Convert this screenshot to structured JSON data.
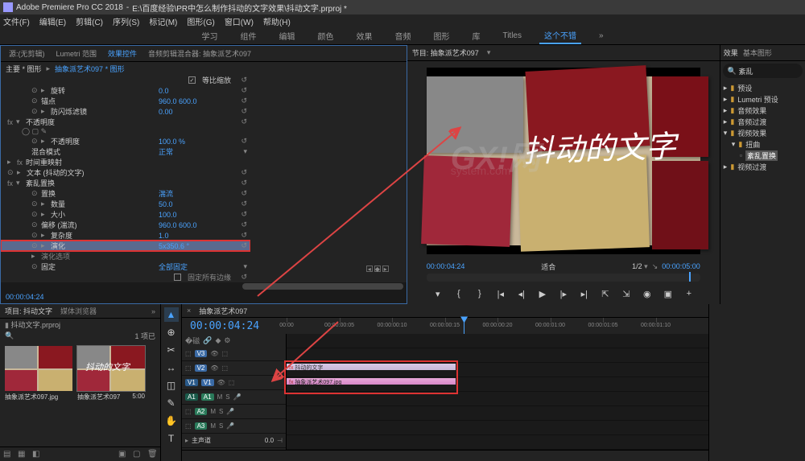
{
  "title_bar": {
    "app": "Adobe Premiere Pro CC 2018",
    "path": "E:\\百度经验\\PR中怎么制作抖动的文字效果\\抖动文字.prproj *"
  },
  "menu": [
    "文件(F)",
    "编辑(E)",
    "剪辑(C)",
    "序列(S)",
    "标记(M)",
    "图形(G)",
    "窗口(W)",
    "帮助(H)"
  ],
  "workspaces": {
    "items": [
      "学习",
      "组件",
      "编辑",
      "颜色",
      "效果",
      "音频",
      "图形",
      "库",
      "Titles"
    ],
    "active": "这个不错",
    "more": "»"
  },
  "effect_controls": {
    "tabs": [
      "源:(无剪辑)",
      "Lumetri 范围",
      "效果控件",
      "音频剪辑混合器: 抽象派艺术097"
    ],
    "active_tab": "效果控件",
    "master_label": "主要 * 图形",
    "clip_link": "抽象派艺术097 * 图形",
    "check_label": "等比缩放",
    "rows": [
      {
        "type": "prop",
        "indent": 2,
        "name": "旋转",
        "val": "0.0"
      },
      {
        "type": "prop",
        "indent": 2,
        "name": "锚点",
        "val": "960.0   600.0"
      },
      {
        "type": "prop",
        "indent": 2,
        "name": "防闪烁滤镜",
        "val": "0.00"
      },
      {
        "type": "fx",
        "indent": 0,
        "name": "不透明度"
      },
      {
        "type": "mask",
        "indent": 1,
        "name": "◯ ▢ ✎"
      },
      {
        "type": "prop",
        "indent": 2,
        "name": "不透明度",
        "val": "100.0 %"
      },
      {
        "type": "prop",
        "indent": 2,
        "name": "混合模式",
        "val": "正常"
      },
      {
        "type": "fx",
        "indent": 0,
        "name": "时间重映射"
      },
      {
        "type": "fx",
        "indent": 0,
        "name": "文本 (抖动的文字)"
      },
      {
        "type": "fx",
        "indent": 0,
        "name": "紊乱置换"
      },
      {
        "type": "prop",
        "indent": 2,
        "name": "置换",
        "val": "湍流"
      },
      {
        "type": "prop",
        "indent": 2,
        "name": "数量",
        "val": "50.0"
      },
      {
        "type": "prop",
        "indent": 2,
        "name": "大小",
        "val": "100.0"
      },
      {
        "type": "prop",
        "indent": 2,
        "name": "偏移 (湍流)",
        "val": "960.0   600.0"
      },
      {
        "type": "prop",
        "indent": 2,
        "name": "复杂度",
        "val": "1.0"
      },
      {
        "type": "prop",
        "indent": 2,
        "name": "演化",
        "val": "5x350.6 °",
        "hl": true
      },
      {
        "type": "prop",
        "indent": 2,
        "name": "演化选项",
        "val": ""
      },
      {
        "type": "prop",
        "indent": 2,
        "name": "固定",
        "val": "全部固定"
      }
    ],
    "pin_check": "固定所有边缘",
    "timecode": "00:00:04:24"
  },
  "program": {
    "title": "节目: 抽象派艺术097",
    "overlay_text": "抖动的文字",
    "left_tc": "00:00:04:24",
    "fit": "适合",
    "zoom": "1/2",
    "right_tc": "00:00:05:00"
  },
  "effects_panel": {
    "tabs": [
      "效果",
      "基本图形"
    ],
    "active": "效果",
    "search": "紊乱",
    "tree": [
      {
        "ind": 0,
        "icon": "▸",
        "label": "预设"
      },
      {
        "ind": 0,
        "icon": "▸",
        "label": "Lumetri 预设"
      },
      {
        "ind": 0,
        "icon": "▸",
        "label": "音频效果"
      },
      {
        "ind": 0,
        "icon": "▸",
        "label": "音频过渡"
      },
      {
        "ind": 0,
        "icon": "▾",
        "label": "视频效果"
      },
      {
        "ind": 1,
        "icon": "▾",
        "label": "扭曲"
      },
      {
        "ind": 2,
        "icon": "",
        "label": "紊乱置换",
        "hl": true
      },
      {
        "ind": 0,
        "icon": "▸",
        "label": "视频过渡"
      }
    ]
  },
  "project": {
    "tabs": [
      "项目: 抖动文字",
      "媒体浏览器"
    ],
    "active": "项目: 抖动文字",
    "file": "抖动文字.prproj",
    "count": "1 项已",
    "bins": [
      {
        "label": "抽象派艺术097.jpg",
        "dur": ""
      },
      {
        "label": "抽象派艺术097",
        "dur": "5:00"
      }
    ]
  },
  "tools": [
    "▲",
    "⊕",
    "✂",
    "↔",
    "◫",
    "✎",
    "✋",
    "T"
  ],
  "timeline": {
    "seq": "抽象派艺术097",
    "tc": "00:00:04:24",
    "ruler": [
      "00:00",
      "00:00:00:05",
      "00:00:00:10",
      "00:00:00:15",
      "00:00:00:20",
      "00:00:01:00",
      "00:00:01:05",
      "00:00:01:10"
    ],
    "playhead_pct": 42,
    "tracks": {
      "v": [
        "V3",
        "V2",
        "V1"
      ],
      "a": [
        "A1",
        "A2",
        "A3"
      ],
      "master": "主声道",
      "master_val": "0.0"
    },
    "clips": {
      "text": "抖动的文字",
      "video": "抽象派艺术097.jpg"
    }
  },
  "watermark": {
    "big": "GX!网",
    "small": "system.com"
  }
}
